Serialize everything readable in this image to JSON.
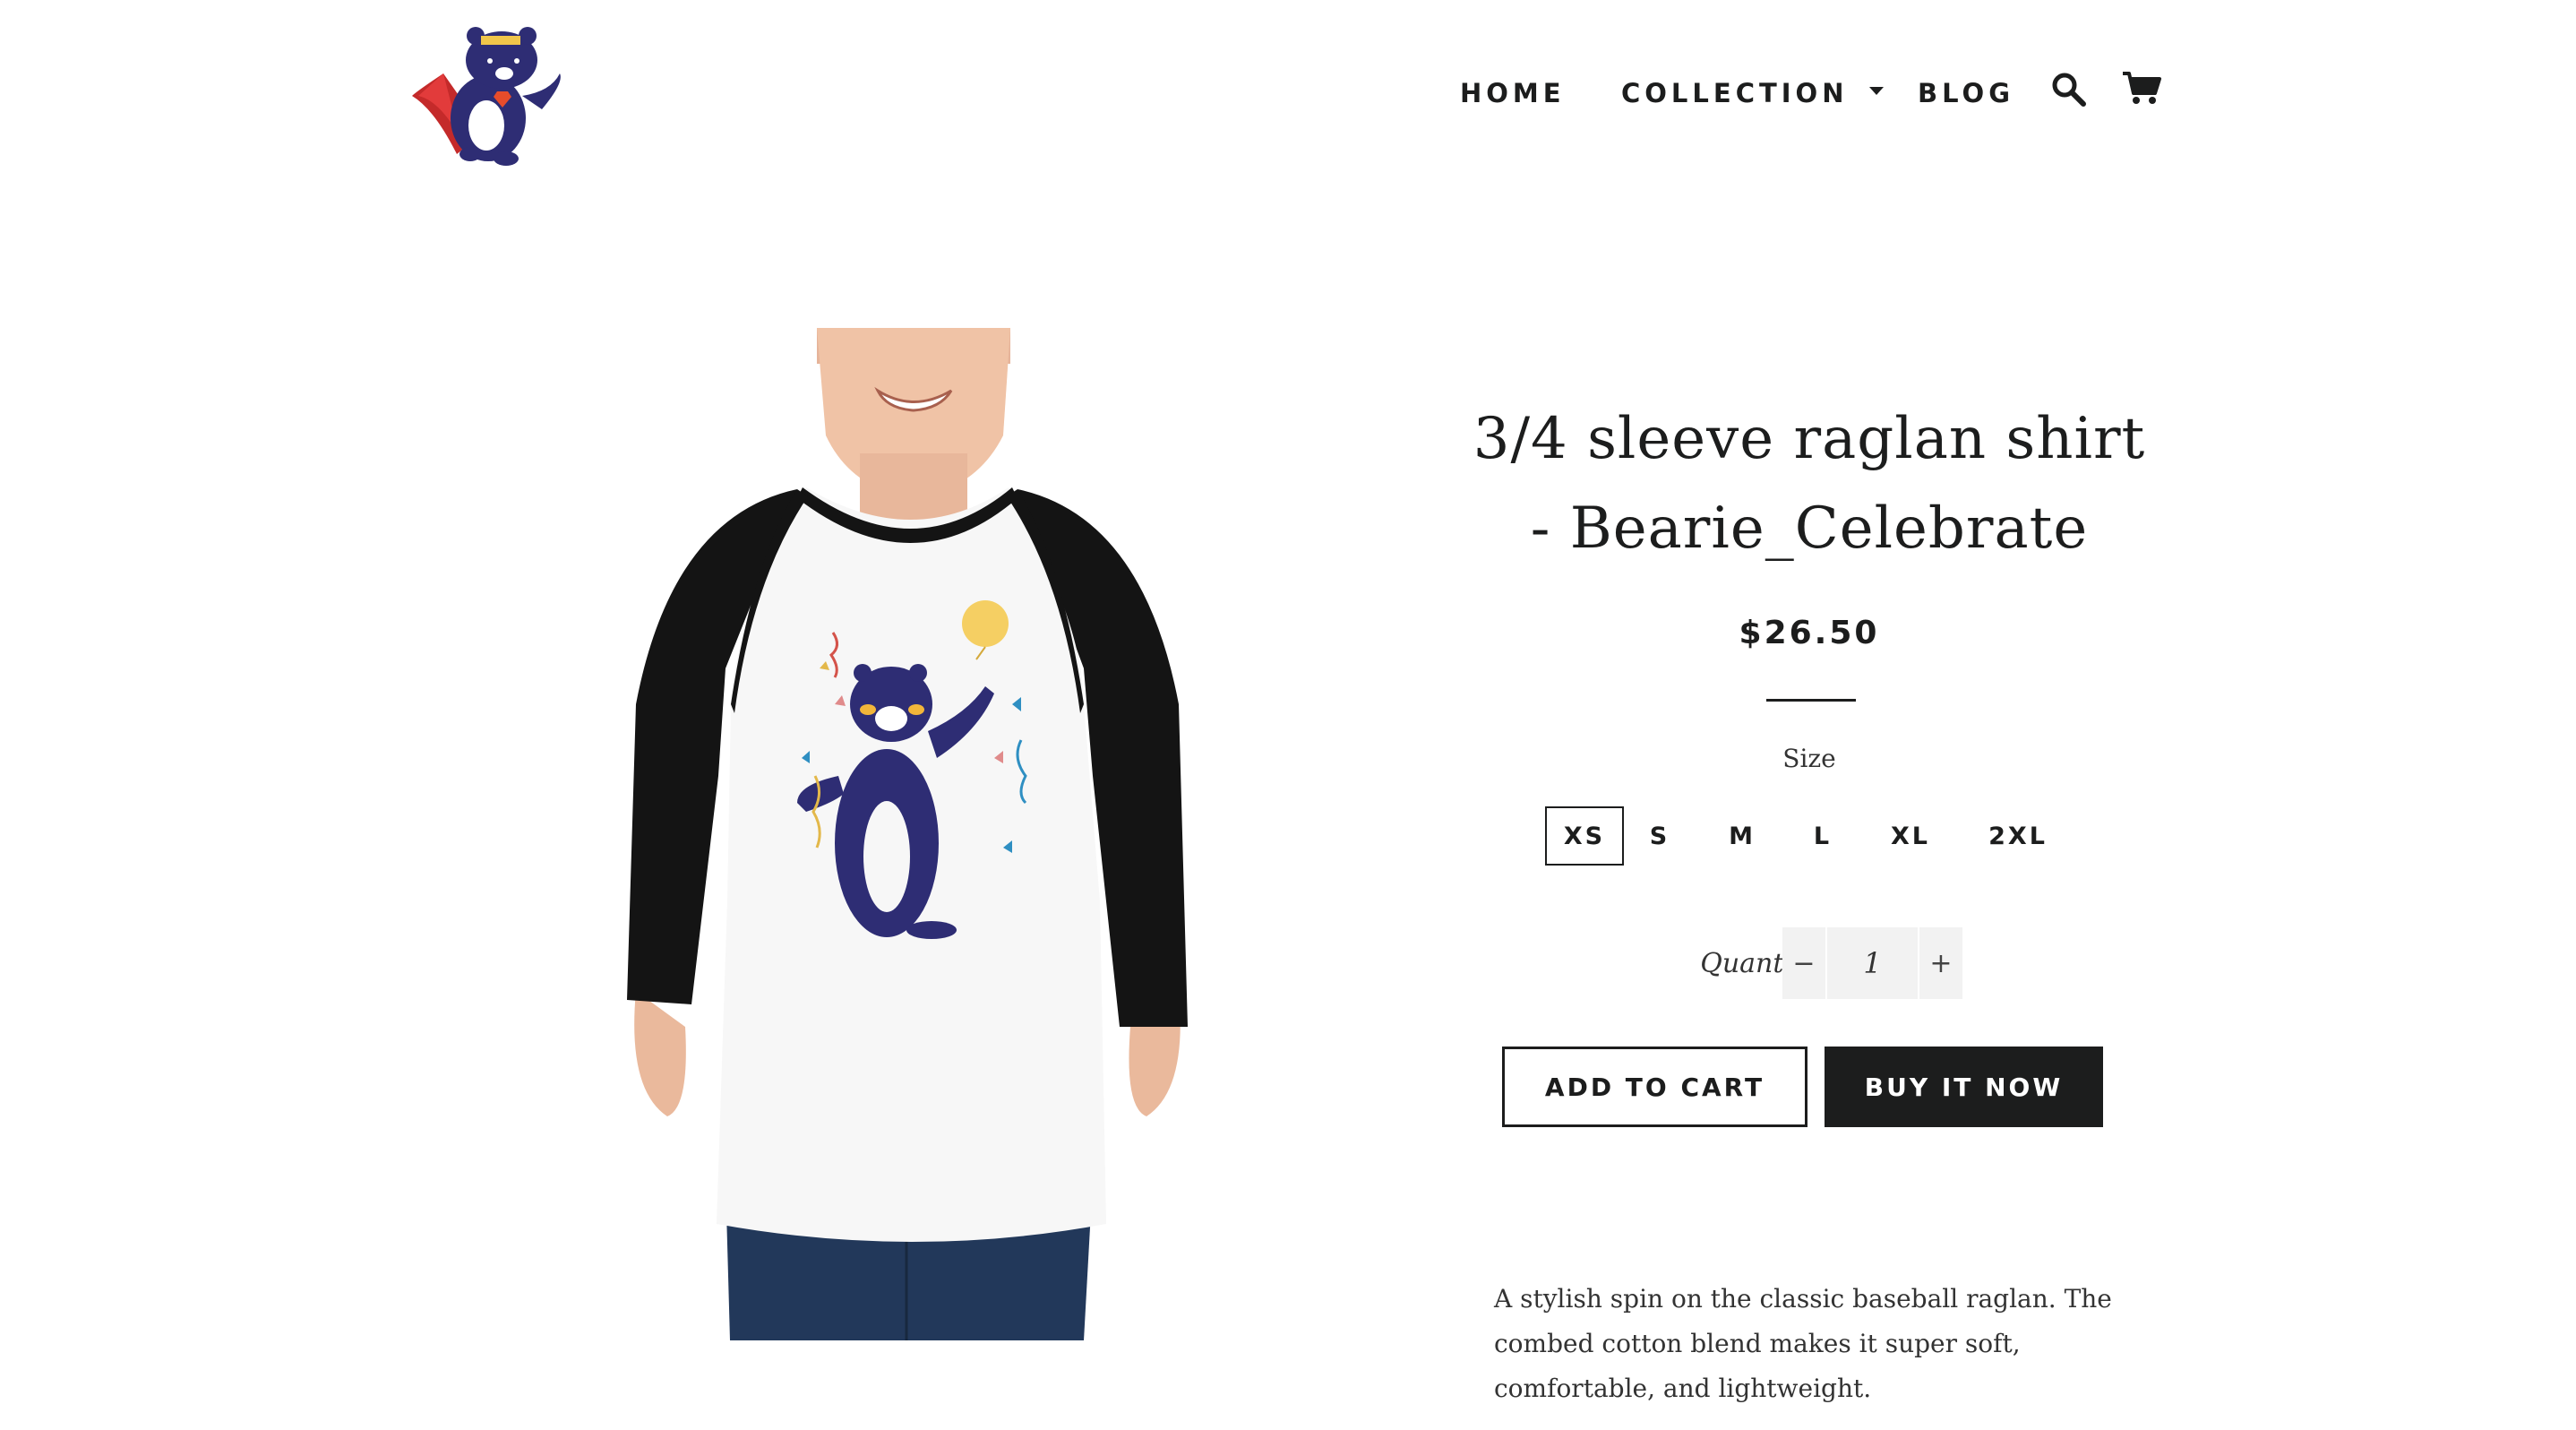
{
  "header": {
    "logo_alt": "Bearie superhero bear logo",
    "nav": {
      "home": "HOME",
      "collection": "COLLECTION",
      "blog": "BLOG"
    },
    "icons": [
      "search-icon",
      "cart-icon"
    ]
  },
  "product": {
    "title": "3/4 sleeve raglan shirt - Bearie_Celebrate",
    "price": "$26.50",
    "size_label": "Size",
    "sizes": [
      "XS",
      "S",
      "M",
      "L",
      "XL",
      "2XL"
    ],
    "selected_size": "XS",
    "quantity_label": "Quantity",
    "quantity": "1",
    "minus_symbol": "−",
    "plus_symbol": "+",
    "add_to_cart": "ADD TO CART",
    "buy_now": "BUY IT NOW",
    "description": "A stylish spin on the classic baseball raglan. The combed cotton blend makes it super soft, comfortable, and lightweight."
  },
  "colors": {
    "text": "#1c1d1d",
    "bear_navy": "#2e2d74",
    "cape_red": "#c42a2a",
    "sleeve_black": "#111111"
  }
}
